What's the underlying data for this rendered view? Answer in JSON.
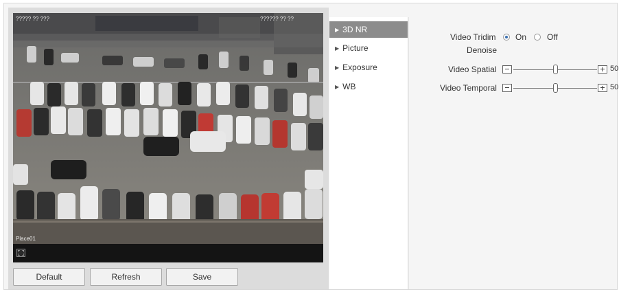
{
  "video": {
    "osd_top_left": "????? ?? ???",
    "osd_top_right": "?????? ?? ??",
    "osd_bottom_left": "Place01"
  },
  "buttons": {
    "default": "Default",
    "refresh": "Refresh",
    "save": "Save"
  },
  "menu": {
    "items": [
      {
        "label": "3D NR",
        "active": true
      },
      {
        "label": "Picture",
        "active": false
      },
      {
        "label": "Exposure",
        "active": false
      },
      {
        "label": "WB",
        "active": false
      }
    ]
  },
  "settings": {
    "tridim_label_line1": "Video Tridim",
    "tridim_label_line2": "Denoise",
    "on_label": "On",
    "off_label": "Off",
    "selected": "On",
    "spatial_label": "Video Spatial",
    "spatial_value": "50",
    "temporal_label": "Video Temporal",
    "temporal_value": "50"
  },
  "colors": {
    "active_menu": "#8c8c8c",
    "radio_selected": "#3a6fb0",
    "video_bar": "#141414"
  }
}
